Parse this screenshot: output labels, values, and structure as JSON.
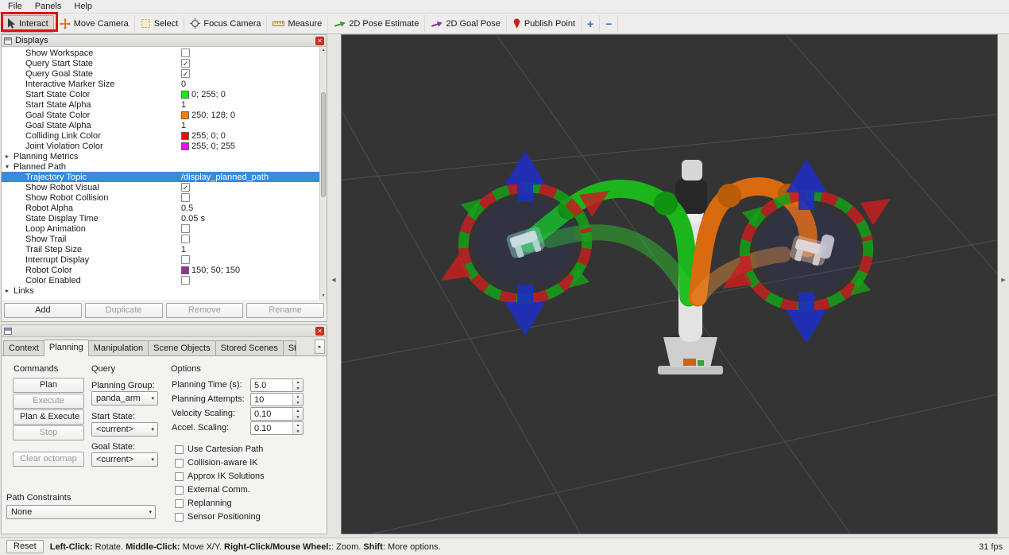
{
  "menu": {
    "items": [
      {
        "label": "File"
      },
      {
        "label": "Panels"
      },
      {
        "label": "Help"
      }
    ]
  },
  "toolbar": {
    "tools": [
      {
        "id": "interact",
        "label": "Interact",
        "icon": "interact-icon",
        "active": true
      },
      {
        "id": "move-camera",
        "label": "Move Camera",
        "icon": "move-camera-icon"
      },
      {
        "id": "select",
        "label": "Select",
        "icon": "select-icon"
      },
      {
        "id": "focus-camera",
        "label": "Focus Camera",
        "icon": "focus-camera-icon"
      },
      {
        "id": "measure",
        "label": "Measure",
        "icon": "measure-icon"
      },
      {
        "id": "pose-estimate",
        "label": "2D Pose Estimate",
        "icon": "pose-estimate-icon"
      },
      {
        "id": "goal-pose",
        "label": "2D Goal Pose",
        "icon": "goal-pose-icon"
      },
      {
        "id": "publish-point",
        "label": "Publish Point",
        "icon": "publish-point-icon"
      },
      {
        "id": "add-tool",
        "label": "",
        "icon": "add-tool-icon"
      },
      {
        "id": "remove-tool",
        "label": "",
        "icon": "remove-tool-icon"
      }
    ]
  },
  "displays_panel": {
    "title": "Displays",
    "rows": [
      {
        "label": "Show Workspace",
        "indent": 2,
        "value": {
          "type": "checkbox",
          "checked": false
        }
      },
      {
        "label": "Query Start State",
        "indent": 2,
        "value": {
          "type": "checkbox",
          "checked": true
        }
      },
      {
        "label": "Query Goal State",
        "indent": 2,
        "value": {
          "type": "checkbox",
          "checked": true
        }
      },
      {
        "label": "Interactive Marker Size",
        "indent": 2,
        "value": {
          "type": "text",
          "text": "0"
        }
      },
      {
        "label": "Start State Color",
        "indent": 2,
        "value": {
          "type": "color",
          "hex": "#00ff00",
          "text": "0; 255; 0"
        }
      },
      {
        "label": "Start State Alpha",
        "indent": 2,
        "value": {
          "type": "text",
          "text": "1"
        }
      },
      {
        "label": "Goal State Color",
        "indent": 2,
        "value": {
          "type": "color",
          "hex": "#fa8000",
          "text": "250; 128; 0"
        }
      },
      {
        "label": "Goal State Alpha",
        "indent": 2,
        "value": {
          "type": "text",
          "text": "1"
        }
      },
      {
        "label": "Colliding Link Color",
        "indent": 2,
        "value": {
          "type": "color",
          "hex": "#ff0000",
          "text": "255; 0; 0"
        }
      },
      {
        "label": "Joint Violation Color",
        "indent": 2,
        "value": {
          "type": "color",
          "hex": "#ff00ff",
          "text": "255; 0; 255"
        }
      },
      {
        "label": "Planning Metrics",
        "indent": 1,
        "arrow": "collapsed",
        "value": {
          "type": "none"
        }
      },
      {
        "label": "Planned Path",
        "indent": 1,
        "arrow": "expanded",
        "value": {
          "type": "none"
        }
      },
      {
        "label": "Trajectory Topic",
        "indent": 2,
        "selected": true,
        "value": {
          "type": "text",
          "text": "/display_planned_path"
        }
      },
      {
        "label": "Show Robot Visual",
        "indent": 2,
        "value": {
          "type": "checkbox",
          "checked": true
        }
      },
      {
        "label": "Show Robot Collision",
        "indent": 2,
        "value": {
          "type": "checkbox",
          "checked": false
        }
      },
      {
        "label": "Robot Alpha",
        "indent": 2,
        "value": {
          "type": "text",
          "text": "0.5"
        }
      },
      {
        "label": "State Display Time",
        "indent": 2,
        "value": {
          "type": "text",
          "text": "0.05 s"
        }
      },
      {
        "label": "Loop Animation",
        "indent": 2,
        "value": {
          "type": "checkbox",
          "checked": false
        }
      },
      {
        "label": "Show Trail",
        "indent": 2,
        "value": {
          "type": "checkbox",
          "checked": false
        }
      },
      {
        "label": "Trail Step Size",
        "indent": 2,
        "value": {
          "type": "text",
          "text": "1"
        }
      },
      {
        "label": "Interrupt Display",
        "indent": 2,
        "value": {
          "type": "checkbox",
          "checked": false
        }
      },
      {
        "label": "Robot Color",
        "indent": 2,
        "value": {
          "type": "color",
          "hex": "#963296",
          "text": "150; 50; 150"
        }
      },
      {
        "label": "Color Enabled",
        "indent": 2,
        "value": {
          "type": "checkbox",
          "checked": false
        }
      },
      {
        "label": "Links",
        "indent": 1,
        "arrow": "collapsed",
        "value": {
          "type": "none"
        }
      }
    ],
    "buttons": [
      {
        "label": "Add",
        "enabled": true
      },
      {
        "label": "Duplicate",
        "enabled": false
      },
      {
        "label": "Remove",
        "enabled": false
      },
      {
        "label": "Rename",
        "enabled": false
      }
    ]
  },
  "planning_panel": {
    "title": "",
    "tabs": [
      {
        "label": "Context",
        "active": false
      },
      {
        "label": "Planning",
        "active": true
      },
      {
        "label": "Manipulation",
        "active": false
      },
      {
        "label": "Scene Objects",
        "active": false
      },
      {
        "label": "Stored Scenes",
        "active": false
      },
      {
        "label": "Sto",
        "active": false,
        "truncated": true
      }
    ],
    "commands": {
      "heading": "Commands",
      "buttons": [
        {
          "label": "Plan",
          "enabled": true
        },
        {
          "label": "Execute",
          "enabled": false
        },
        {
          "label": "Plan & Execute",
          "enabled": true
        },
        {
          "label": "Stop",
          "enabled": false
        },
        {
          "label": "Clear octomap",
          "enabled": false
        }
      ]
    },
    "query": {
      "heading": "Query",
      "fields": [
        {
          "label": "Planning Group:",
          "value": "panda_arm"
        },
        {
          "label": "Start State:",
          "value": "<current>"
        },
        {
          "label": "Goal State:",
          "value": "<current>"
        }
      ]
    },
    "options": {
      "heading": "Options",
      "spinners": [
        {
          "label": "Planning Time (s):",
          "value": "5.0"
        },
        {
          "label": "Planning Attempts:",
          "value": "10"
        },
        {
          "label": "Velocity Scaling:",
          "value": "0.10"
        },
        {
          "label": "Accel. Scaling:",
          "value": "0.10"
        }
      ],
      "checkboxes": [
        {
          "label": "Use Cartesian Path",
          "checked": false
        },
        {
          "label": "Collision-aware IK",
          "checked": false
        },
        {
          "label": "Approx IK Solutions",
          "checked": false
        },
        {
          "label": "External Comm.",
          "checked": false
        },
        {
          "label": "Replanning",
          "checked": false
        },
        {
          "label": "Sensor Positioning",
          "checked": false
        }
      ]
    },
    "path_constraints": {
      "heading": "Path Constraints",
      "value": "None"
    }
  },
  "viewport": {
    "colors": {
      "background": "#343434",
      "grid": "#4a4a4a",
      "start": "#1cb51c",
      "goal": "#d86a10",
      "marker_blue": "#1e2fbe",
      "marker_red": "#c42020",
      "ring_green": "#18a018",
      "ring_red": "#c42020"
    }
  },
  "status_bar": {
    "reset_label": "Reset",
    "segments": [
      {
        "text": "Left-Click:",
        "bold": true
      },
      {
        "text": " Rotate.  ",
        "bold": false
      },
      {
        "text": "Middle-Click:",
        "bold": true
      },
      {
        "text": " Move X/Y.  ",
        "bold": false
      },
      {
        "text": "Right-Click/Mouse Wheel:",
        "bold": true
      },
      {
        "text": ": Zoom.  ",
        "bold": false
      },
      {
        "text": "Shift",
        "bold": true
      },
      {
        "text": ": More options.",
        "bold": false
      }
    ],
    "fps": "31 fps"
  },
  "icons": {
    "close": "✕",
    "arrow-collapsed": "▸",
    "arrow-expanded": "▾",
    "dropdown": "▾",
    "spin-up": "▲",
    "spin-down": "▼",
    "scroll-up": "▲",
    "scroll-down": "▼",
    "check": "✓",
    "tab-scroll-right": "▸",
    "splitter-left": "◀",
    "splitter-right": "▶",
    "plus": "+",
    "minus": "−"
  }
}
